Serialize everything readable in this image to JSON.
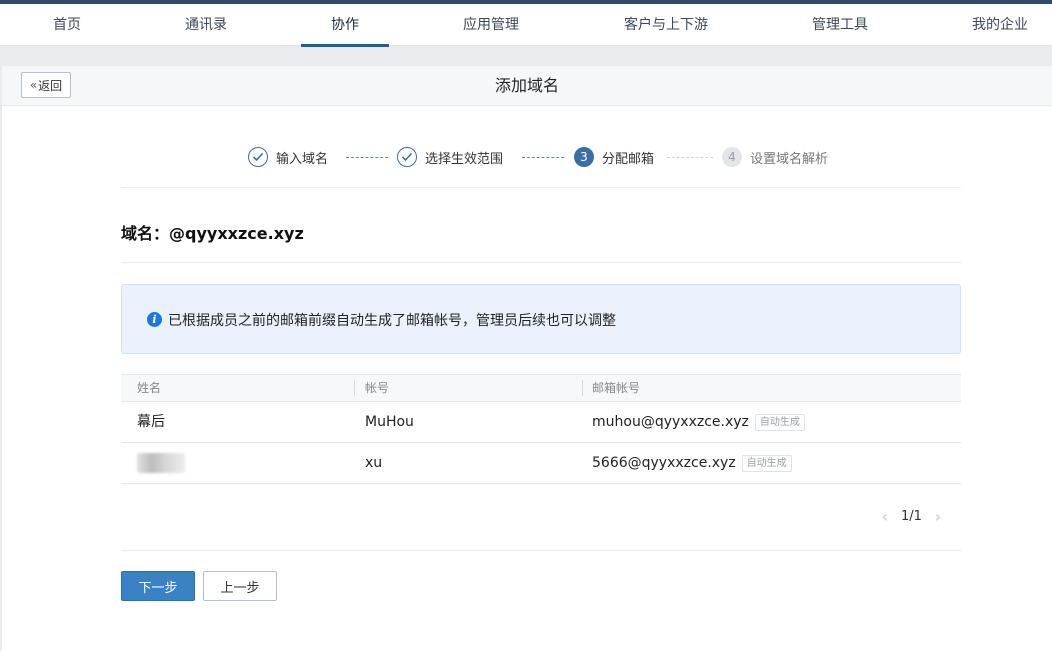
{
  "nav": {
    "items": [
      {
        "label": "首页"
      },
      {
        "label": "通讯录"
      },
      {
        "label": "协作"
      },
      {
        "label": "应用管理"
      },
      {
        "label": "客户与上下游"
      },
      {
        "label": "管理工具"
      },
      {
        "label": "我的企业"
      }
    ],
    "active": "协作"
  },
  "header": {
    "back_label": "返回",
    "title": "添加域名"
  },
  "steps": [
    {
      "label": "输入域名",
      "status": "done",
      "marker": ""
    },
    {
      "label": "选择生效范围",
      "status": "done",
      "marker": ""
    },
    {
      "label": "分配邮箱",
      "status": "current",
      "marker": "3"
    },
    {
      "label": "设置域名解析",
      "status": "pending",
      "marker": "4"
    }
  ],
  "domain": {
    "label": "域名：",
    "value": "@qyyxxzce.xyz"
  },
  "notice": {
    "icon": "info-icon",
    "text": "已根据成员之前的邮箱前缀自动生成了邮箱帐号，管理员后续也可以调整"
  },
  "table": {
    "columns": [
      "姓名",
      "帐号",
      "邮箱帐号"
    ],
    "rows": [
      {
        "name": "幕后",
        "account": "MuHou",
        "email": "muhou@qyyxxzce.xyz",
        "tag": "自动生成"
      },
      {
        "name": "",
        "account": "xu",
        "email": "5666@qyyxxzce.xyz",
        "tag": "自动生成"
      }
    ]
  },
  "pagination": {
    "text": "1/1"
  },
  "actions": {
    "next_label": "下一步",
    "prev_label": "上一步"
  },
  "colors": {
    "primary": "#3b82c4",
    "step_active": "#3a6ea5",
    "notice_bg": "#eaf1fc",
    "nav_topline": "#2f4a6a"
  }
}
